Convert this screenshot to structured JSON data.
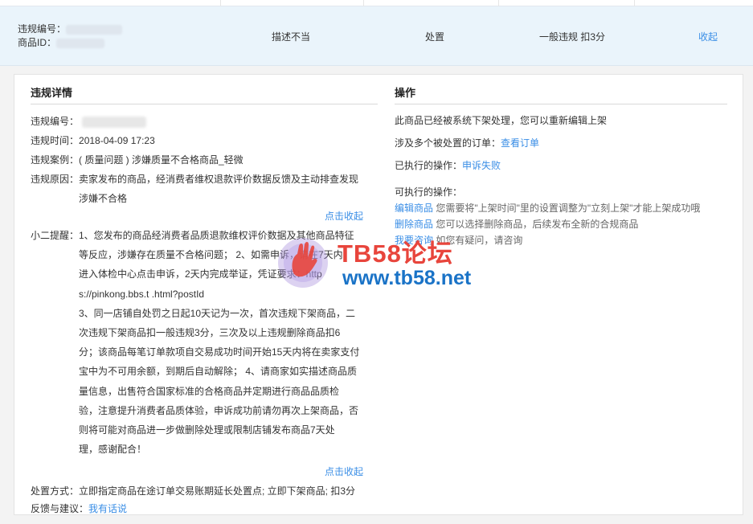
{
  "summary": {
    "violation_no_label": "违规编号：",
    "product_id_label": "商品ID：",
    "reason": "描述不当",
    "action": "处置",
    "level": "一般违规 扣3分",
    "collapse": "收起"
  },
  "details": {
    "title": "违规详情",
    "violation_no_label": "违规编号：",
    "time_label": "违规时间：",
    "time_value": "2018-04-09 17:23",
    "case_label": "违规案例：",
    "case_value": "( 质量问题 ) 涉嫌质量不合格商品_轻微",
    "reason_label": "违规原因：",
    "reason_lines": [
      "卖家发布的商品，经消费者维权退款评价数据反馈及主动排查发现",
      "涉嫌不合格"
    ],
    "collapse_link_1": "点击收起",
    "reminder_label": "小二提醒：",
    "reminder_lines": [
      "1、您发布的商品经消费者品质退款维权评价数据及其他商品特征",
      "等反应，涉嫌存在质量不合格问题； 2、如需申诉，请在7天内",
      "进入体检中心点击申诉，2天内完成举证，凭证要求：http",
      "s://pinkong.bbs.t                        .html?postId",
      "3、同一店铺自处罚之日起10天记为一次，首次违规下架商品，二",
      "次违规下架商品扣一般违规3分，三次及以上违规删除商品扣6",
      "分；该商品每笔订单款项自交易成功时间开始15天内将在卖家支付",
      "宝中为不可用余额，到期后自动解除； 4、请商家如实描述商品质",
      "量信息，出售符合国家标准的合格商品并定期进行商品品质检",
      "验，注意提升消费者品质体验，申诉成功前请勿再次上架商品，否",
      "则将可能对商品进一步做删除处理或限制店铺发布商品7天处",
      "理，感谢配合！"
    ],
    "collapse_link_2": "点击收起",
    "handling_label": "处置方式：",
    "handling_value": "立即指定商品在途订单交易账期延长处置点; 立即下架商品; 扣3分",
    "feedback_label": "反馈与建议：",
    "feedback_link": "我有话说"
  },
  "operations": {
    "title": "操作",
    "status_text": "此商品已经被系统下架处理，您可以重新编辑上架",
    "orders_text": "涉及多个被处置的订单：",
    "orders_link": "查看订单",
    "executed_text": "已执行的操作：",
    "executed_link": "申诉失败",
    "available_label": "可执行的操作：",
    "edit_link": "编辑商品",
    "edit_desc": "您需要将\"上架时间\"里的设置调整为\"立刻上架\"才能上架成功哦",
    "delete_link": "删除商品",
    "delete_desc": "您可以选择删除商品，后续发布全新的合规商品",
    "consult_link": "我要咨询",
    "consult_desc": "如您有疑问，请咨询"
  },
  "watermark": {
    "top": "TB58论坛",
    "bottom": "www.tb58.net"
  }
}
